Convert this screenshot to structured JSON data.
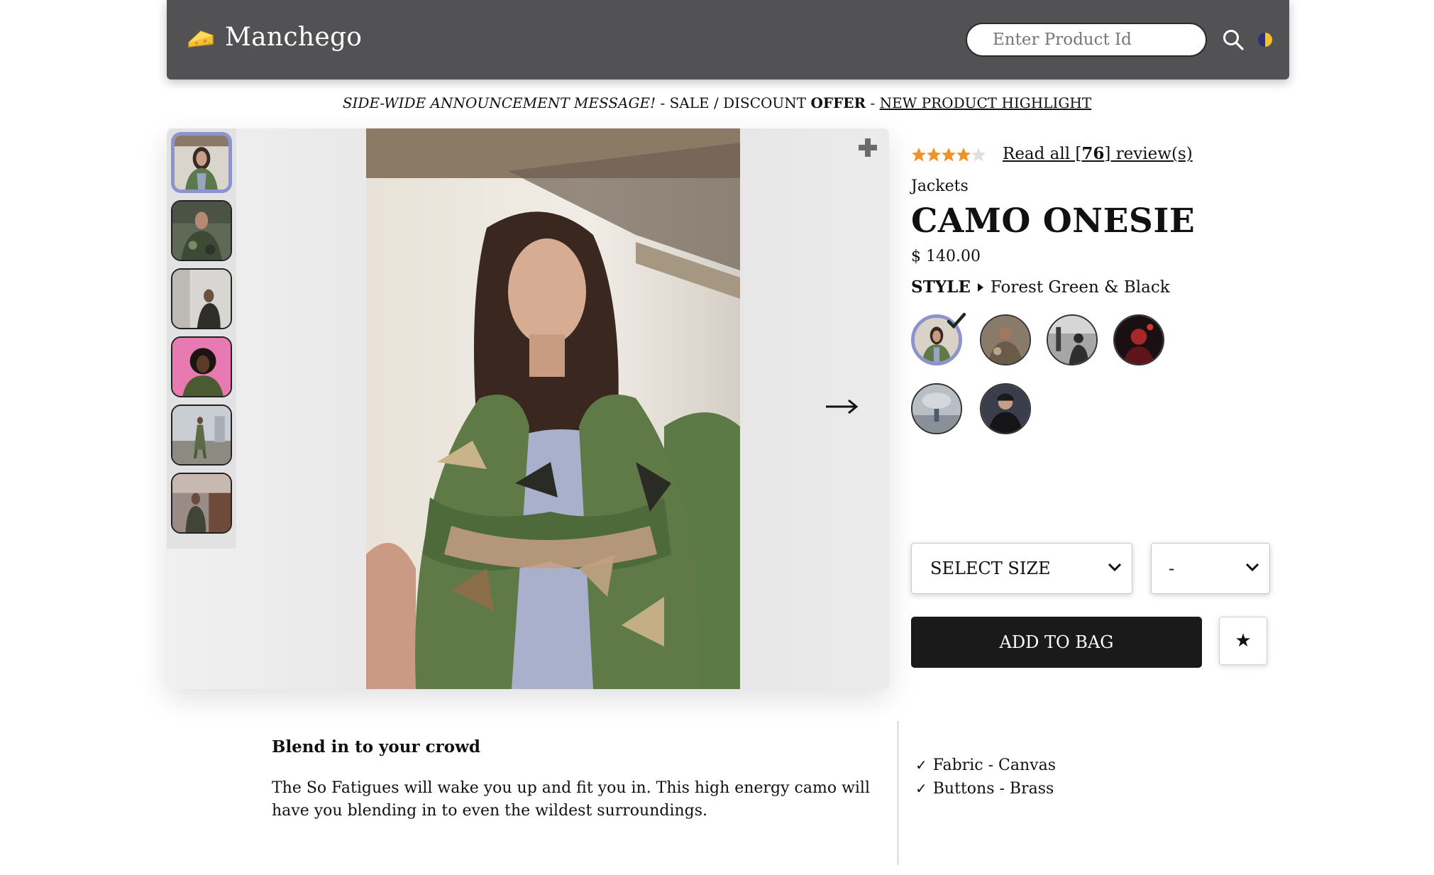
{
  "header": {
    "brand": "Manchego",
    "logo_icon": "cheese-icon",
    "search": {
      "placeholder": "Enter Product Id",
      "value": ""
    },
    "search_icon": "search-icon",
    "theme_icon": "half-moon-icon"
  },
  "announcement": {
    "message": "SIDE-WIDE ANNOUNCEMENT MESSAGE!",
    "sep1": " - ",
    "sale": "SALE / DISCOUNT ",
    "offer": "OFFER",
    "sep2": " - ",
    "highlight": "NEW PRODUCT HIGHLIGHT"
  },
  "gallery": {
    "thumbnails": [
      "photo-1",
      "photo-2",
      "photo-3",
      "photo-4",
      "photo-5",
      "photo-6"
    ],
    "selected_index": 0,
    "zoom_icon": "plus-icon",
    "next_icon": "arrow-right-icon"
  },
  "product": {
    "rating": 4,
    "rating_max": 5,
    "reviews_prefix": "Read all [",
    "reviews_count": "76",
    "reviews_suffix": "] review(s)",
    "category": "Jackets",
    "title": "CAMO ONESIE",
    "price": "$ 140.00",
    "style_label": "STYLE",
    "style_value": "Forest Green & Black",
    "swatch_count": 6,
    "selected_swatch": 0,
    "size_select": "SELECT SIZE",
    "qty_select": "-",
    "add_to_bag": "ADD TO BAG",
    "favorite_icon": "★"
  },
  "description": {
    "heading": "Blend in to your crowd",
    "body": "The So Fatigues will wake you up and fit you in. This high energy camo will have you blending in to even the wildest surroundings.",
    "features": [
      "Fabric - Canvas",
      "Buttons - Brass"
    ],
    "feature_tick": "✓"
  },
  "colors": {
    "header_bg": "#525154",
    "accent": "#8e93cc",
    "button_bg": "#1b1a1a",
    "star": "#f0922b"
  }
}
